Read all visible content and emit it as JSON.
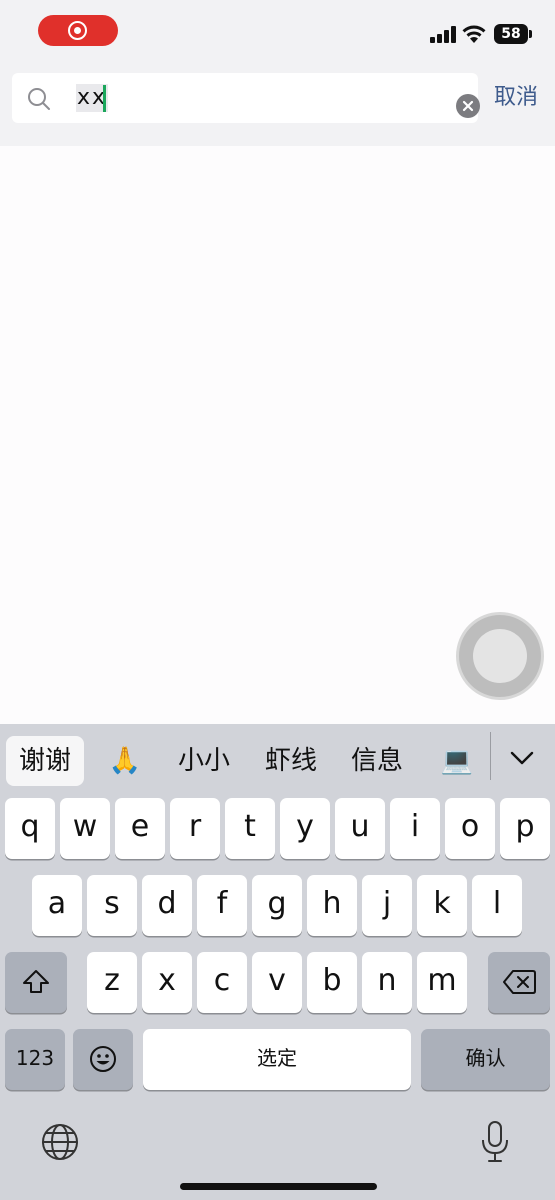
{
  "status_bar": {
    "battery": "58",
    "icons": [
      "record-indicator-icon",
      "cellular-signal-icon",
      "wifi-icon",
      "battery-icon"
    ]
  },
  "search": {
    "query": "xx",
    "cancel_label": "取消"
  },
  "keyboard": {
    "candidates": [
      "谢谢",
      "🙏",
      "小小",
      "虾线",
      "信息",
      "💻"
    ],
    "row1": [
      "q",
      "w",
      "e",
      "r",
      "t",
      "y",
      "u",
      "i",
      "o",
      "p"
    ],
    "row2": [
      "a",
      "s",
      "d",
      "f",
      "g",
      "h",
      "j",
      "k",
      "l"
    ],
    "row3": [
      "z",
      "x",
      "c",
      "v",
      "b",
      "n",
      "m"
    ],
    "numbers_label": "123",
    "space_label": "选定",
    "return_label": "确认",
    "icons": [
      "shift-icon",
      "backspace-icon",
      "emoji-icon",
      "globe-icon",
      "microphone-icon",
      "chevron-down-icon"
    ]
  },
  "colors": {
    "accent_link": "#3e5b8c",
    "caret": "#1ba65b",
    "record": "#e0302b"
  }
}
